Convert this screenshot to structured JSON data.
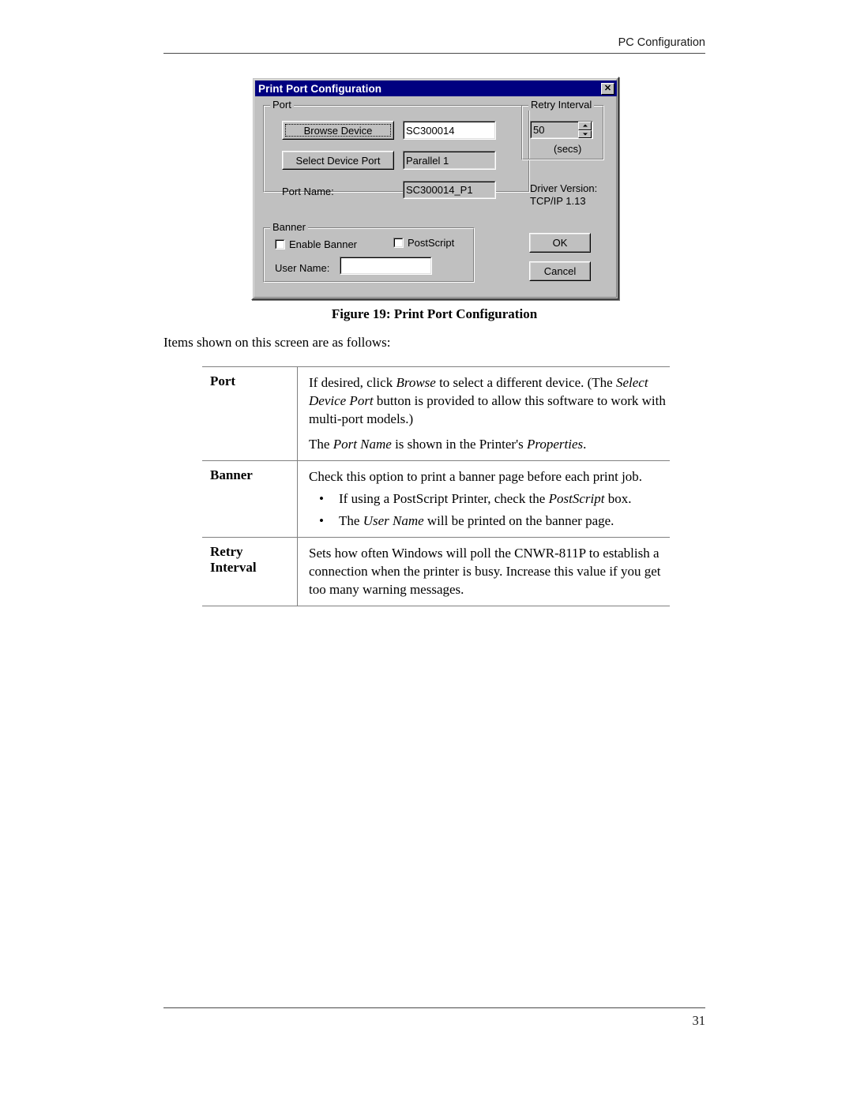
{
  "page": {
    "header_text": "PC Configuration",
    "page_number": "31"
  },
  "dialog": {
    "title": "Print Port Configuration",
    "close_icon": "✕",
    "port_group": {
      "label": "Port",
      "browse_device_button": "Browse Device",
      "device_name_value": "SC300014",
      "select_device_port_button": "Select Device Port",
      "device_port_value": "Parallel 1",
      "port_name_label": "Port Name:",
      "port_name_value": "SC300014_P1"
    },
    "retry_group": {
      "label": "Retry Interval",
      "value": "50",
      "units": "(secs)"
    },
    "driver_version": "Driver Version:\nTCP/IP  1.13",
    "banner_group": {
      "label": "Banner",
      "enable_banner_label": "Enable Banner",
      "postscript_label": "PostScript",
      "user_name_label": "User Name:",
      "user_name_value": ""
    },
    "ok_button": "OK",
    "cancel_button": "Cancel"
  },
  "figure": {
    "caption": "Figure 19: Print Port Configuration"
  },
  "body": {
    "intro": "Items shown on this screen are as follows:"
  },
  "table": {
    "rows": [
      {
        "term": "Port",
        "para1_a": "If desired, click ",
        "para1_i1": "Browse",
        "para1_b": " to select a different device. (The ",
        "para1_i2": "Select Device Port",
        "para1_c": " button is provided to allow this software to work with multi-port models.)",
        "para2_a": "The ",
        "para2_i1": "Port Name",
        "para2_b": " is shown in the Printer's ",
        "para2_i2": "Properties",
        "para2_c": "."
      },
      {
        "term": "Banner",
        "para1": "Check this option to print a banner page before each print job.",
        "bullet_char": "•",
        "b1_a": "If using a PostScript Printer, check the ",
        "b1_i": "PostScript",
        "b1_b": " box.",
        "b2_a": "The ",
        "b2_i": "User Name",
        "b2_b": " will be printed on the banner page."
      },
      {
        "term_line1": "Retry",
        "term_line2": "Interval",
        "para1": "Sets how often Windows will poll the CNWR-811P to establish a connection when the printer is busy. Increase this value if you get too many warning messages."
      }
    ]
  },
  "colors": {
    "titlebar": "#000080",
    "dialog_face": "#c0c0c0",
    "field_bg": "#ffffff",
    "rule": "#4a4a4a"
  }
}
